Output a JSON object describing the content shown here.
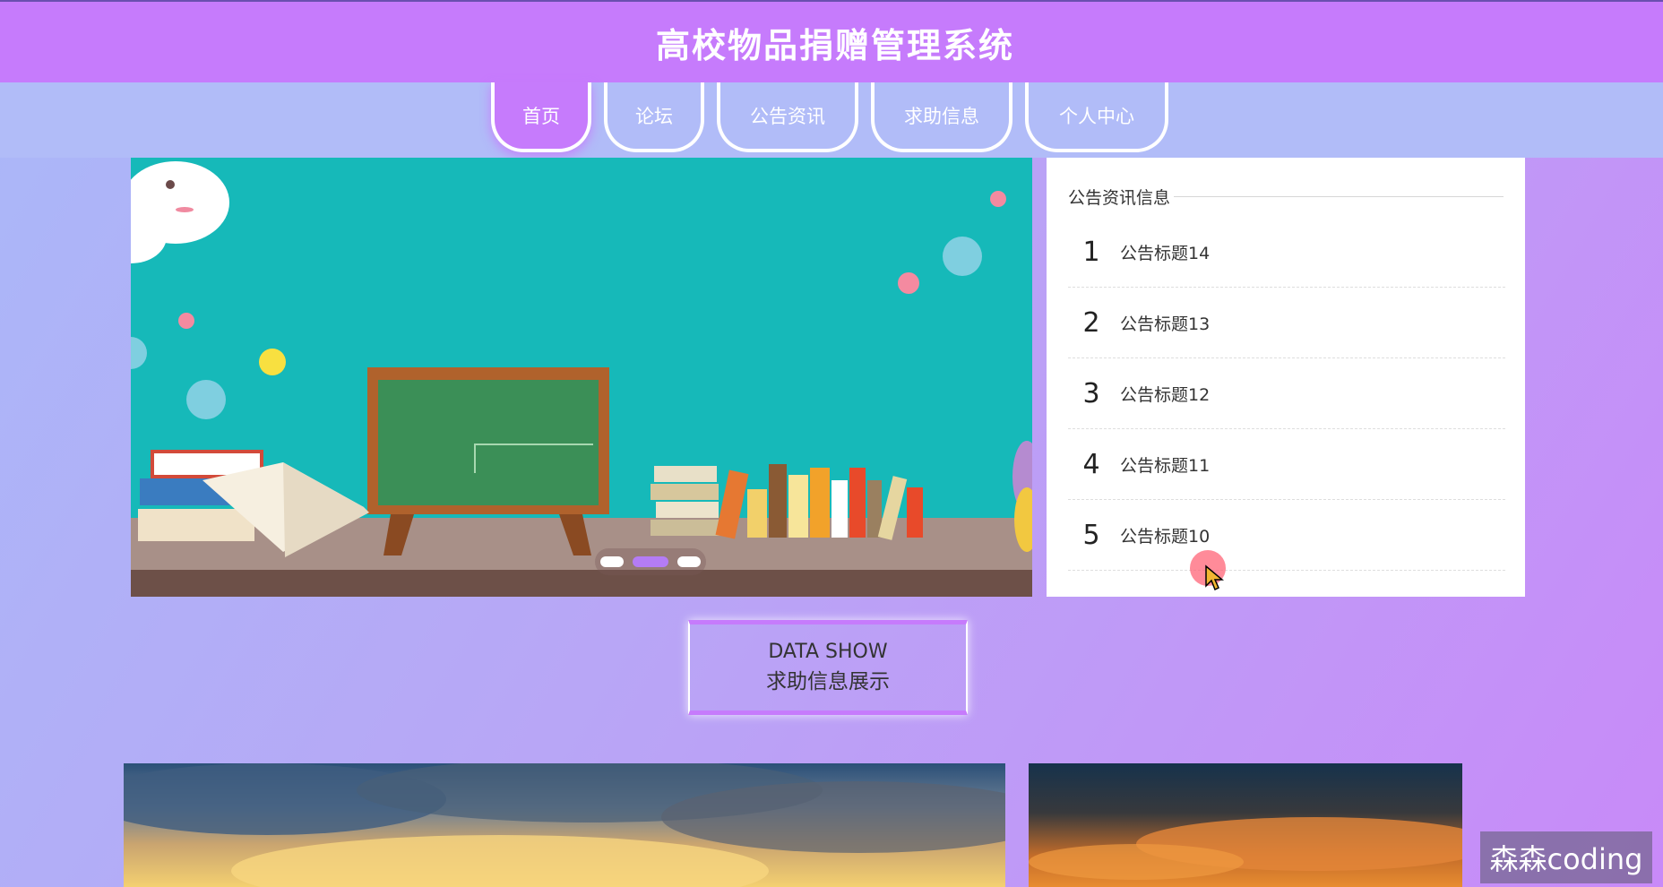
{
  "header": {
    "title": "高校物品捐赠管理系统"
  },
  "nav": {
    "items": [
      {
        "label": "首页",
        "active": true
      },
      {
        "label": "论坛",
        "active": false
      },
      {
        "label": "公告资讯",
        "active": false
      },
      {
        "label": "求助信息",
        "active": false
      },
      {
        "label": "个人中心",
        "active": false
      }
    ]
  },
  "carousel": {
    "slide_count": 3,
    "active_index": 1
  },
  "notices": {
    "title": "公告资讯信息",
    "items": [
      {
        "num": "1",
        "title": "公告标题14"
      },
      {
        "num": "2",
        "title": "公告标题13"
      },
      {
        "num": "3",
        "title": "公告标题12"
      },
      {
        "num": "4",
        "title": "公告标题11"
      },
      {
        "num": "5",
        "title": "公告标题10"
      }
    ]
  },
  "datashow": {
    "en": "DATA SHOW",
    "cn": "求助信息展示"
  },
  "watermark": "森森coding",
  "colors": {
    "header_bg": "#c67bfc",
    "nav_bg": "#b1bcf8",
    "accent": "#c67bfc",
    "banner_bg": "#16b9b9"
  }
}
